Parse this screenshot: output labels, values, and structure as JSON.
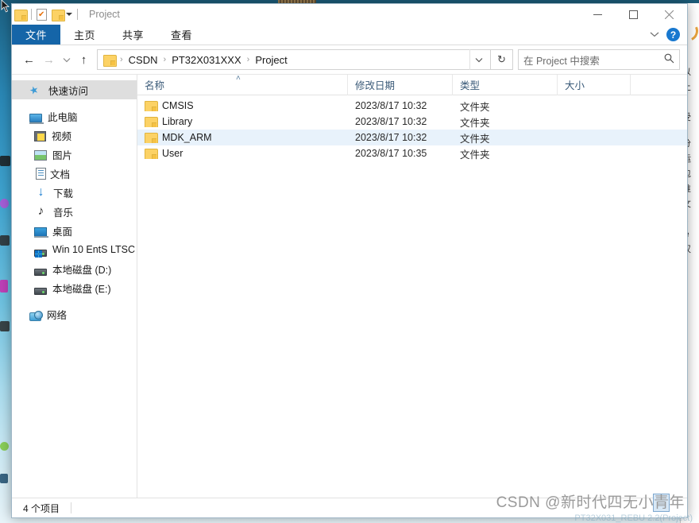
{
  "window": {
    "title": "Project",
    "quick_access": [
      {
        "name": "folder-icon",
        "label": ""
      },
      {
        "name": "properties-icon",
        "label": ""
      },
      {
        "name": "new-folder-icon",
        "label": ""
      }
    ],
    "controls": {
      "minimize": "—",
      "maximize": "☐",
      "close": "✕"
    }
  },
  "ribbon": {
    "tabs": [
      {
        "label": "文件",
        "active": true
      },
      {
        "label": "主页",
        "active": false
      },
      {
        "label": "共享",
        "active": false
      },
      {
        "label": "查看",
        "active": false
      }
    ],
    "collapse_chevron": "⌄",
    "help_label": "?",
    "accent_color": "#1565a8"
  },
  "toolbar": {
    "back": "←",
    "forward": "→",
    "recent_dropdown": "⌄",
    "up": "↑",
    "refresh": "↻",
    "address_dropdown": "⌄"
  },
  "breadcrumb": {
    "separator": "›",
    "items": [
      "CSDN",
      "PT32X031XXX",
      "Project"
    ]
  },
  "search": {
    "placeholder": "在 Project 中搜索",
    "icon": "⚲"
  },
  "sidebar": {
    "groups": [
      {
        "items": [
          {
            "label": "快速访问",
            "icon": "pin-icon",
            "selected": true,
            "level": 1
          }
        ]
      },
      {
        "items": [
          {
            "label": "此电脑",
            "icon": "this-pc-icon",
            "selected": false,
            "level": 1
          },
          {
            "label": "视频",
            "icon": "videos-icon",
            "selected": false,
            "level": 2
          },
          {
            "label": "图片",
            "icon": "pictures-icon",
            "selected": false,
            "level": 2
          },
          {
            "label": "文档",
            "icon": "documents-icon",
            "selected": false,
            "level": 2
          },
          {
            "label": "下载",
            "icon": "downloads-icon",
            "selected": false,
            "level": 2
          },
          {
            "label": "音乐",
            "icon": "music-icon",
            "selected": false,
            "level": 2
          },
          {
            "label": "桌面",
            "icon": "desktop-icon",
            "selected": false,
            "level": 2
          },
          {
            "label": "Win 10 EntS LTSC ›",
            "icon": "windows-drive-icon",
            "selected": false,
            "level": 2
          },
          {
            "label": "本地磁盘 (D:)",
            "icon": "drive-icon",
            "selected": false,
            "level": 2
          },
          {
            "label": "本地磁盘 (E:)",
            "icon": "drive-icon",
            "selected": false,
            "level": 2
          }
        ]
      },
      {
        "items": [
          {
            "label": "网络",
            "icon": "network-icon",
            "selected": false,
            "level": 1
          }
        ]
      }
    ]
  },
  "filelist": {
    "columns": [
      {
        "label": "名称",
        "sorted": "asc",
        "sort_glyph": "˄"
      },
      {
        "label": "修改日期",
        "sorted": "",
        "sort_glyph": ""
      },
      {
        "label": "类型",
        "sorted": "",
        "sort_glyph": ""
      },
      {
        "label": "大小",
        "sorted": "",
        "sort_glyph": ""
      }
    ],
    "rows": [
      {
        "name": "CMSIS",
        "date": "2023/8/17 10:32",
        "type": "文件夹",
        "size": "",
        "icon": "folder-icon",
        "highlighted": false
      },
      {
        "name": "Library",
        "date": "2023/8/17 10:32",
        "type": "文件夹",
        "size": "",
        "icon": "folder-icon",
        "highlighted": false
      },
      {
        "name": "MDK_ARM",
        "date": "2023/8/17 10:32",
        "type": "文件夹",
        "size": "",
        "icon": "folder-icon",
        "highlighted": true
      },
      {
        "name": "User",
        "date": "2023/8/17 10:35",
        "type": "文件夹",
        "size": "",
        "icon": "folder-icon",
        "highlighted": false
      }
    ]
  },
  "statusbar": {
    "item_count": "4 个项目"
  },
  "watermark": {
    "prefix": "CSDN @新时代四无小",
    "boxed": "青",
    "suffix": "年",
    "subtitle": "PT32X031_REBU 2.2(Project)"
  },
  "background": {
    "doc_lines": [
      "以",
      "上",
      "L",
      "受",
      "分",
      "运",
      "包",
      "谁",
      "文",
      "K",
      "ie",
      "汉"
    ]
  }
}
